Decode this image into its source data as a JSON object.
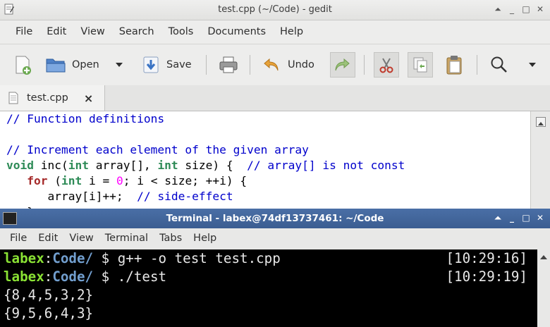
{
  "gedit": {
    "title": "test.cpp (~/Code) - gedit",
    "menu": [
      "File",
      "Edit",
      "View",
      "Search",
      "Tools",
      "Documents",
      "Help"
    ],
    "toolbar": {
      "open_label": "Open",
      "save_label": "Save",
      "undo_label": "Undo"
    },
    "tab": {
      "label": "test.cpp",
      "close": "×"
    },
    "code_lines": [
      [
        {
          "t": "// Function definitions",
          "c": "c-com"
        }
      ],
      [],
      [
        {
          "t": "// Increment each element of the given array",
          "c": "c-com"
        }
      ],
      [
        {
          "t": "void",
          "c": "c-type"
        },
        {
          "t": " inc("
        },
        {
          "t": "int",
          "c": "c-type"
        },
        {
          "t": " array[], "
        },
        {
          "t": "int",
          "c": "c-type"
        },
        {
          "t": " size) {  "
        },
        {
          "t": "// array[] is not const",
          "c": "c-com"
        }
      ],
      [
        {
          "t": "   "
        },
        {
          "t": "for",
          "c": "c-kw"
        },
        {
          "t": " ("
        },
        {
          "t": "int",
          "c": "c-type"
        },
        {
          "t": " i = "
        },
        {
          "t": "0",
          "c": "c-num"
        },
        {
          "t": "; i < size; ++i) {"
        }
      ],
      [
        {
          "t": "      array[i]++;  "
        },
        {
          "t": "// side-effect",
          "c": "c-com"
        }
      ],
      [
        {
          "t": "   }"
        }
      ]
    ]
  },
  "terminal": {
    "title": "Terminal - labex@74df13737461: ~/Code",
    "menu": [
      "File",
      "Edit",
      "View",
      "Terminal",
      "Tabs",
      "Help"
    ],
    "prompt_user": "labex",
    "prompt_sep": ":",
    "prompt_dir": "Code/",
    "prompt_symbol": " $ ",
    "cmd1": "g++ -o test test.cpp",
    "ts1": "[10:29:16]",
    "cmd2": "./test",
    "ts2": "[10:29:19]",
    "out1": "{8,4,5,3,2}",
    "out2": "{9,5,6,4,3}"
  }
}
